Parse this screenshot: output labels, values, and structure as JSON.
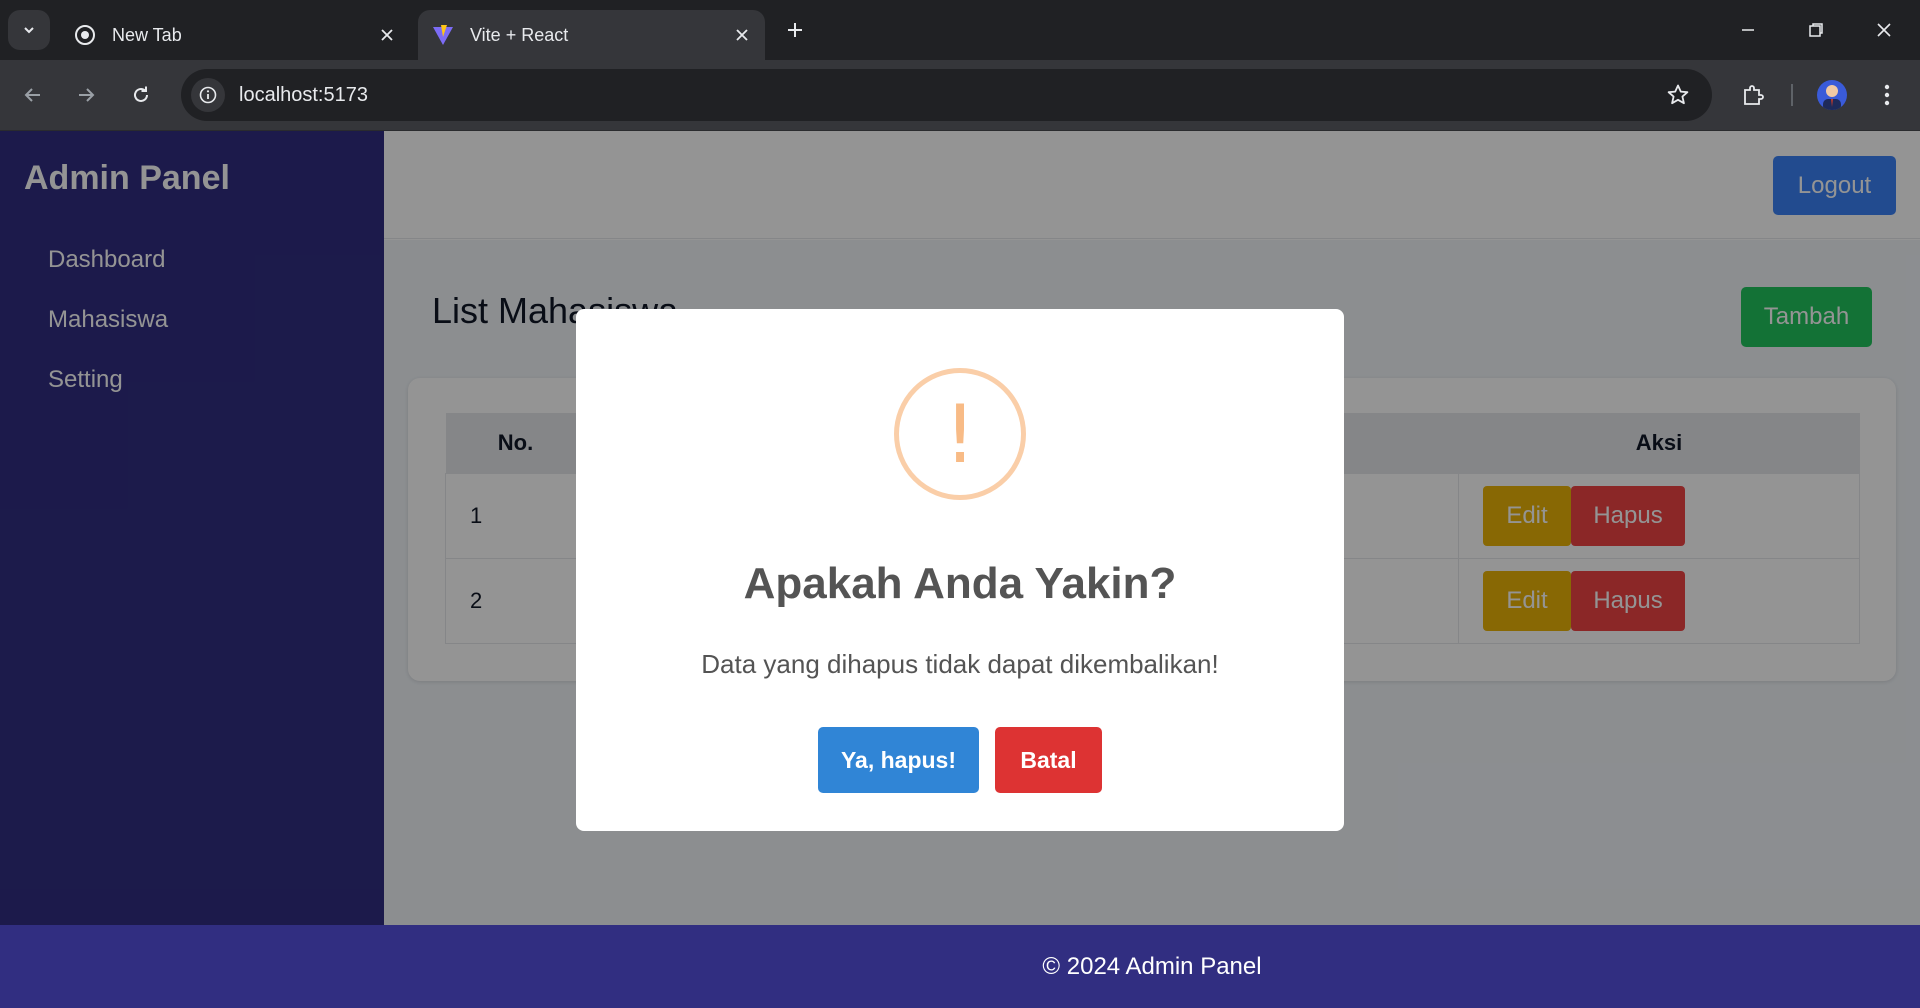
{
  "browser": {
    "tabs": [
      {
        "title": "New Tab",
        "icon": "chrome-icon",
        "active": false
      },
      {
        "title": "Vite + React",
        "icon": "vite-icon",
        "active": true
      }
    ],
    "url": "localhost:5173"
  },
  "sidebar": {
    "brand": "Admin Panel",
    "items": [
      {
        "label": "Dashboard"
      },
      {
        "label": "Mahasiswa"
      },
      {
        "label": "Setting"
      }
    ]
  },
  "header": {
    "logout_label": "Logout"
  },
  "main": {
    "title": "List Mahasiswa",
    "add_label": "Tambah",
    "table": {
      "columns": [
        "No.",
        "Aksi"
      ],
      "rows": [
        {
          "no": "1",
          "edit": "Edit",
          "delete": "Hapus"
        },
        {
          "no": "2",
          "edit": "Edit",
          "delete": "Hapus"
        }
      ]
    }
  },
  "modal": {
    "icon": "!",
    "title": "Apakah Anda Yakin?",
    "text": "Data yang dihapus tidak dapat dikembalikan!",
    "confirm_label": "Ya, hapus!",
    "cancel_label": "Batal"
  },
  "footer": {
    "text": "© 2024 Admin Panel"
  },
  "colors": {
    "sidebar": "#312e81",
    "logout": "#3b82f6",
    "tambah": "#22c55e",
    "edit": "#eab308",
    "hapus": "#ef4444",
    "confirm": "#3085d6",
    "cancel": "#dd3333",
    "warning": "#f8bb86"
  }
}
